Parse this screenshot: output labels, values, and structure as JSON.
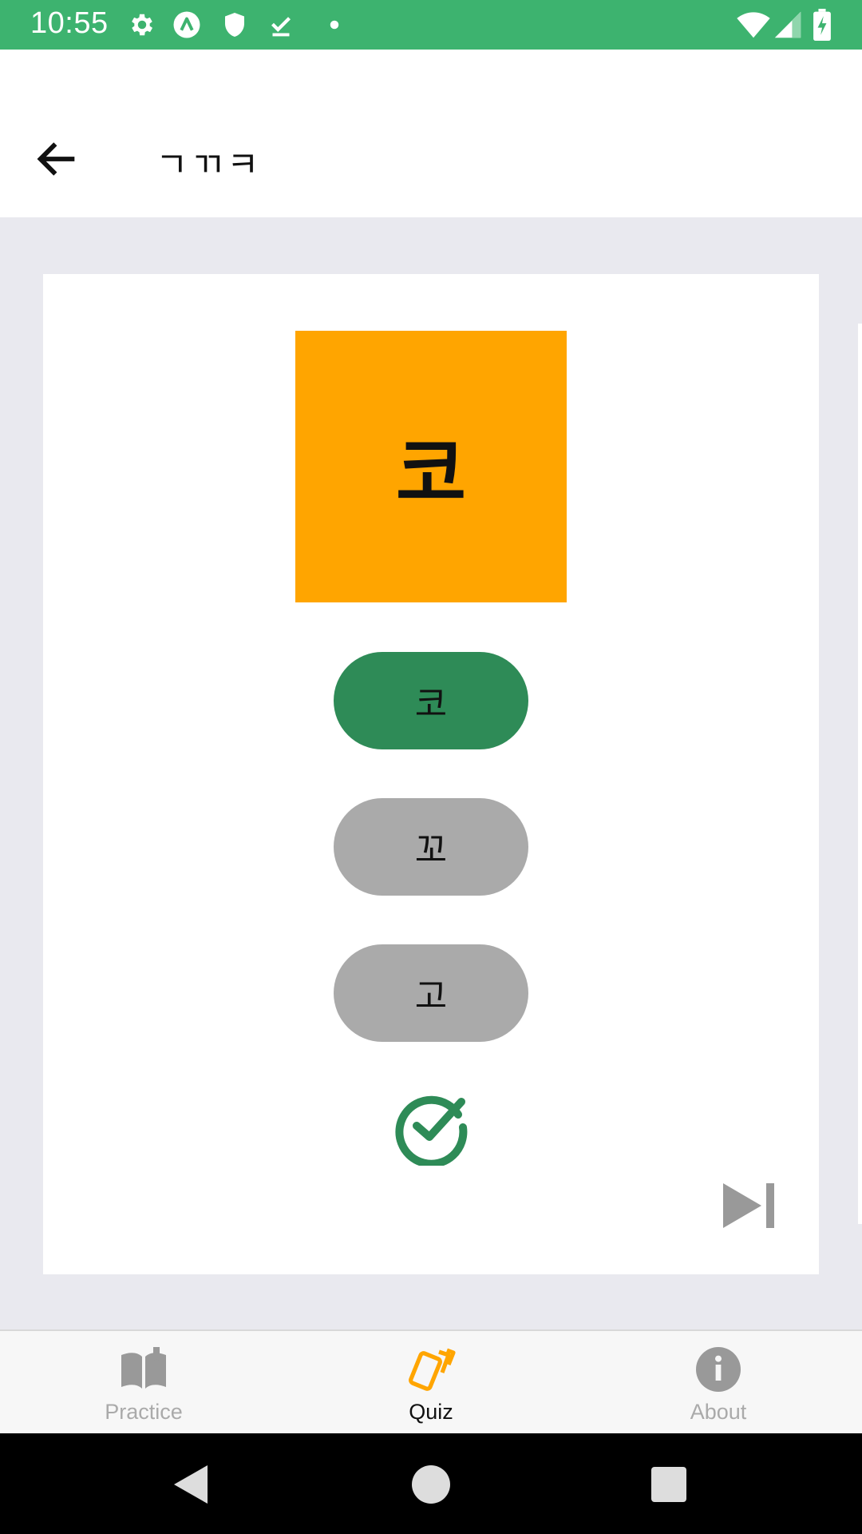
{
  "status_bar": {
    "time": "10:55",
    "icons": [
      "gear-icon",
      "accessibility-icon",
      "shield-icon",
      "download-done-icon",
      "dot-icon",
      "wifi-icon",
      "signal-icon",
      "battery-charging-icon"
    ],
    "background": "#3db36f"
  },
  "app_bar": {
    "title": "ㄱㄲㅋ",
    "back_icon": "arrow-left-icon"
  },
  "quiz": {
    "prompt": "코",
    "prompt_bg": "#ffa500",
    "options": [
      {
        "label": "코",
        "state": "correct"
      },
      {
        "label": "꼬",
        "state": "neutral"
      },
      {
        "label": "고",
        "state": "neutral"
      }
    ],
    "result_icon": "check-circle-icon",
    "skip_icon": "skip-next-icon",
    "colors": {
      "correct": "#2e8b57",
      "neutral": "#aaaaaa"
    }
  },
  "bottom_nav": {
    "items": [
      {
        "label": "Practice",
        "icon": "book-icon",
        "active": false
      },
      {
        "label": "Quiz",
        "icon": "cards-icon",
        "active": true
      },
      {
        "label": "About",
        "icon": "info-icon",
        "active": false
      }
    ],
    "active_color": "#ffa500"
  },
  "system_nav": {
    "icons": [
      "back-triangle-icon",
      "home-circle-icon",
      "recents-square-icon"
    ]
  }
}
